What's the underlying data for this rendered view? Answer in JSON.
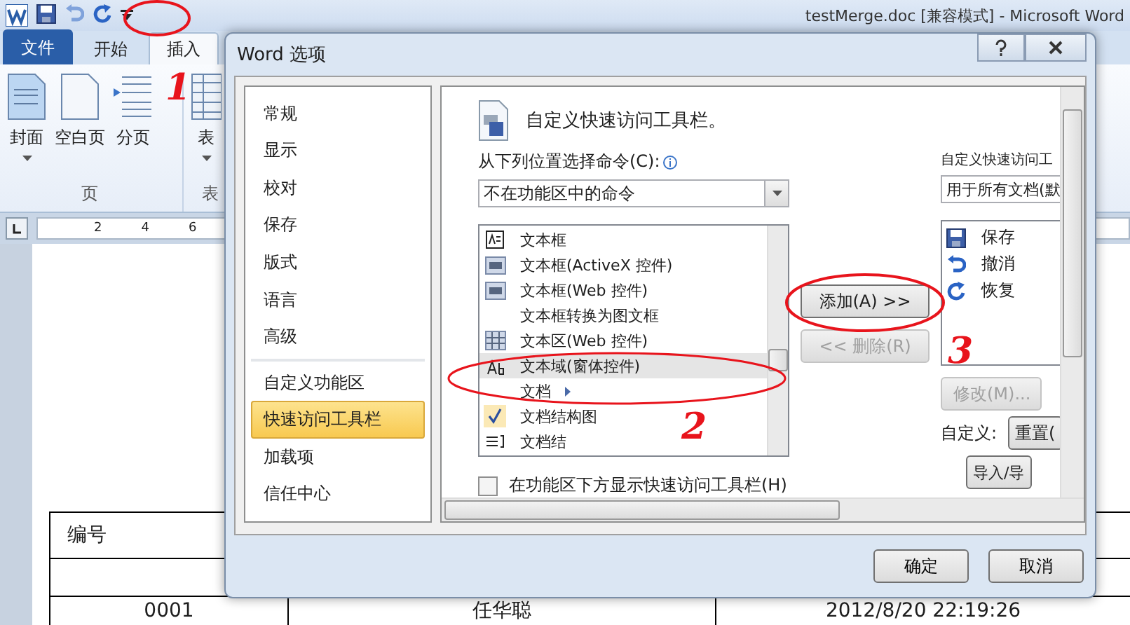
{
  "word_window": {
    "title": "testMerge.doc [兼容模式] - Microsoft Word",
    "ribbon_tabs": [
      {
        "label": "文件",
        "kind": "file",
        "selected": false
      },
      {
        "label": "开始",
        "kind": "plain",
        "selected": false
      },
      {
        "label": "插入",
        "kind": "plain",
        "selected": true
      }
    ],
    "ribbon_buttons": [
      {
        "label": "封面",
        "kind": "cover",
        "dropdown": true
      },
      {
        "label": "空白页",
        "kind": "blank",
        "dropdown": false
      },
      {
        "label": "分页",
        "kind": "break",
        "dropdown": false
      },
      {
        "label": "表",
        "kind": "table",
        "dropdown": true
      }
    ],
    "ribbon_groups": [
      "页",
      "表"
    ],
    "ruler_marks": [
      "2",
      "4",
      "6"
    ],
    "table_rows": [
      [
        "编号"
      ],
      [],
      [
        "0001",
        "任华聪",
        "2012/8/20 22:19:26"
      ]
    ]
  },
  "dialog": {
    "title": "Word 选项",
    "nav_sections": [
      {
        "items": [
          {
            "label": "常规",
            "selected": false
          },
          {
            "label": "显示",
            "selected": false
          },
          {
            "label": "校对",
            "selected": false
          },
          {
            "label": "保存",
            "selected": false
          },
          {
            "label": "版式",
            "selected": false
          },
          {
            "label": "语言",
            "selected": false
          },
          {
            "label": "高级",
            "selected": false
          }
        ]
      },
      {
        "items": [
          {
            "label": "自定义功能区",
            "selected": false
          },
          {
            "label": "快速访问工具栏",
            "selected": true
          },
          {
            "label": "加载项",
            "selected": false
          },
          {
            "label": "信任中心",
            "selected": false
          }
        ]
      }
    ],
    "heading": "自定义快速访问工具栏。",
    "choose_label": "从下列位置选择命令(C):",
    "choose_value": "不在功能区中的命令",
    "target_label": "自定义快速访问工",
    "target_value": "用于所有文档(默",
    "commands": [
      {
        "label": "文本框",
        "kind": "textbox",
        "submenu": false,
        "selected": false
      },
      {
        "label": "文本框(ActiveX 控件)",
        "kind": "abl",
        "submenu": false,
        "selected": false
      },
      {
        "label": "文本框(Web 控件)",
        "kind": "abl",
        "submenu": false,
        "selected": false
      },
      {
        "label": "文本框转换为图文框",
        "kind": "none",
        "submenu": false,
        "selected": false
      },
      {
        "label": "文本区(Web 控件)",
        "kind": "grid",
        "submenu": false,
        "selected": false
      },
      {
        "label": "文本域(窗体控件)",
        "kind": "ab",
        "submenu": false,
        "selected": true
      },
      {
        "label": "文档",
        "kind": "none",
        "submenu": true,
        "selected": false
      },
      {
        "label": "文档结构图",
        "kind": "check",
        "submenu": false,
        "selected": false
      },
      {
        "label": "文档结",
        "kind": "lines",
        "submenu": false,
        "selected": false
      }
    ],
    "add_button": {
      "label": "添加(A) >>",
      "disabled": false
    },
    "remove_button": {
      "label": "<< 删除(R)",
      "disabled": true
    },
    "toolbar_items": [
      {
        "label": "保存",
        "kind": "save"
      },
      {
        "label": "撤消",
        "kind": "undo"
      },
      {
        "label": "恢复",
        "kind": "redo"
      }
    ],
    "modify_button": {
      "label": "修改(M)...",
      "disabled": true
    },
    "customize_label": "自定义:",
    "reset_button": "重置(",
    "import_button": "导入/导",
    "below_ribbon": {
      "label": "在功能区下方显示快速访问工具栏(H)",
      "checked": false
    },
    "ok_button": "确定",
    "cancel_button": "取消"
  },
  "annotations": [
    {
      "number": "1"
    },
    {
      "number": "2"
    },
    {
      "number": "3"
    }
  ]
}
